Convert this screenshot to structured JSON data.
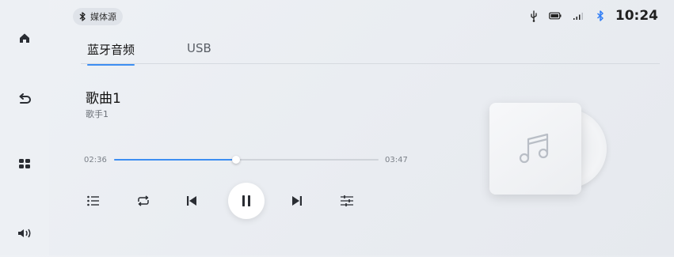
{
  "sidebar": {
    "items": [
      {
        "icon": "home-icon"
      },
      {
        "icon": "back-icon"
      },
      {
        "icon": "apps-icon"
      },
      {
        "icon": "volume-icon"
      }
    ]
  },
  "header": {
    "source_chip": {
      "icon": "bluetooth-icon",
      "label": "媒体源"
    },
    "status": {
      "icons": [
        "usb-icon",
        "battery-icon",
        "signal-icon",
        "bluetooth-icon"
      ],
      "time": "10:24"
    }
  },
  "tabs": [
    {
      "label": "蓝牙音频",
      "active": true
    },
    {
      "label": "USB",
      "active": false
    }
  ],
  "player": {
    "song_title": "歌曲1",
    "artist": "歌手1",
    "current_time": "02:36",
    "total_time": "03:47",
    "progress": 0.46,
    "controls": [
      "playlist-icon",
      "repeat-icon",
      "previous-icon",
      "pause-icon",
      "next-icon",
      "equalizer-icon"
    ],
    "album_art_icon": "music-note-icon"
  },
  "colors": {
    "accent": "#3d8ef2",
    "bluetooth": "#2f7df6"
  }
}
